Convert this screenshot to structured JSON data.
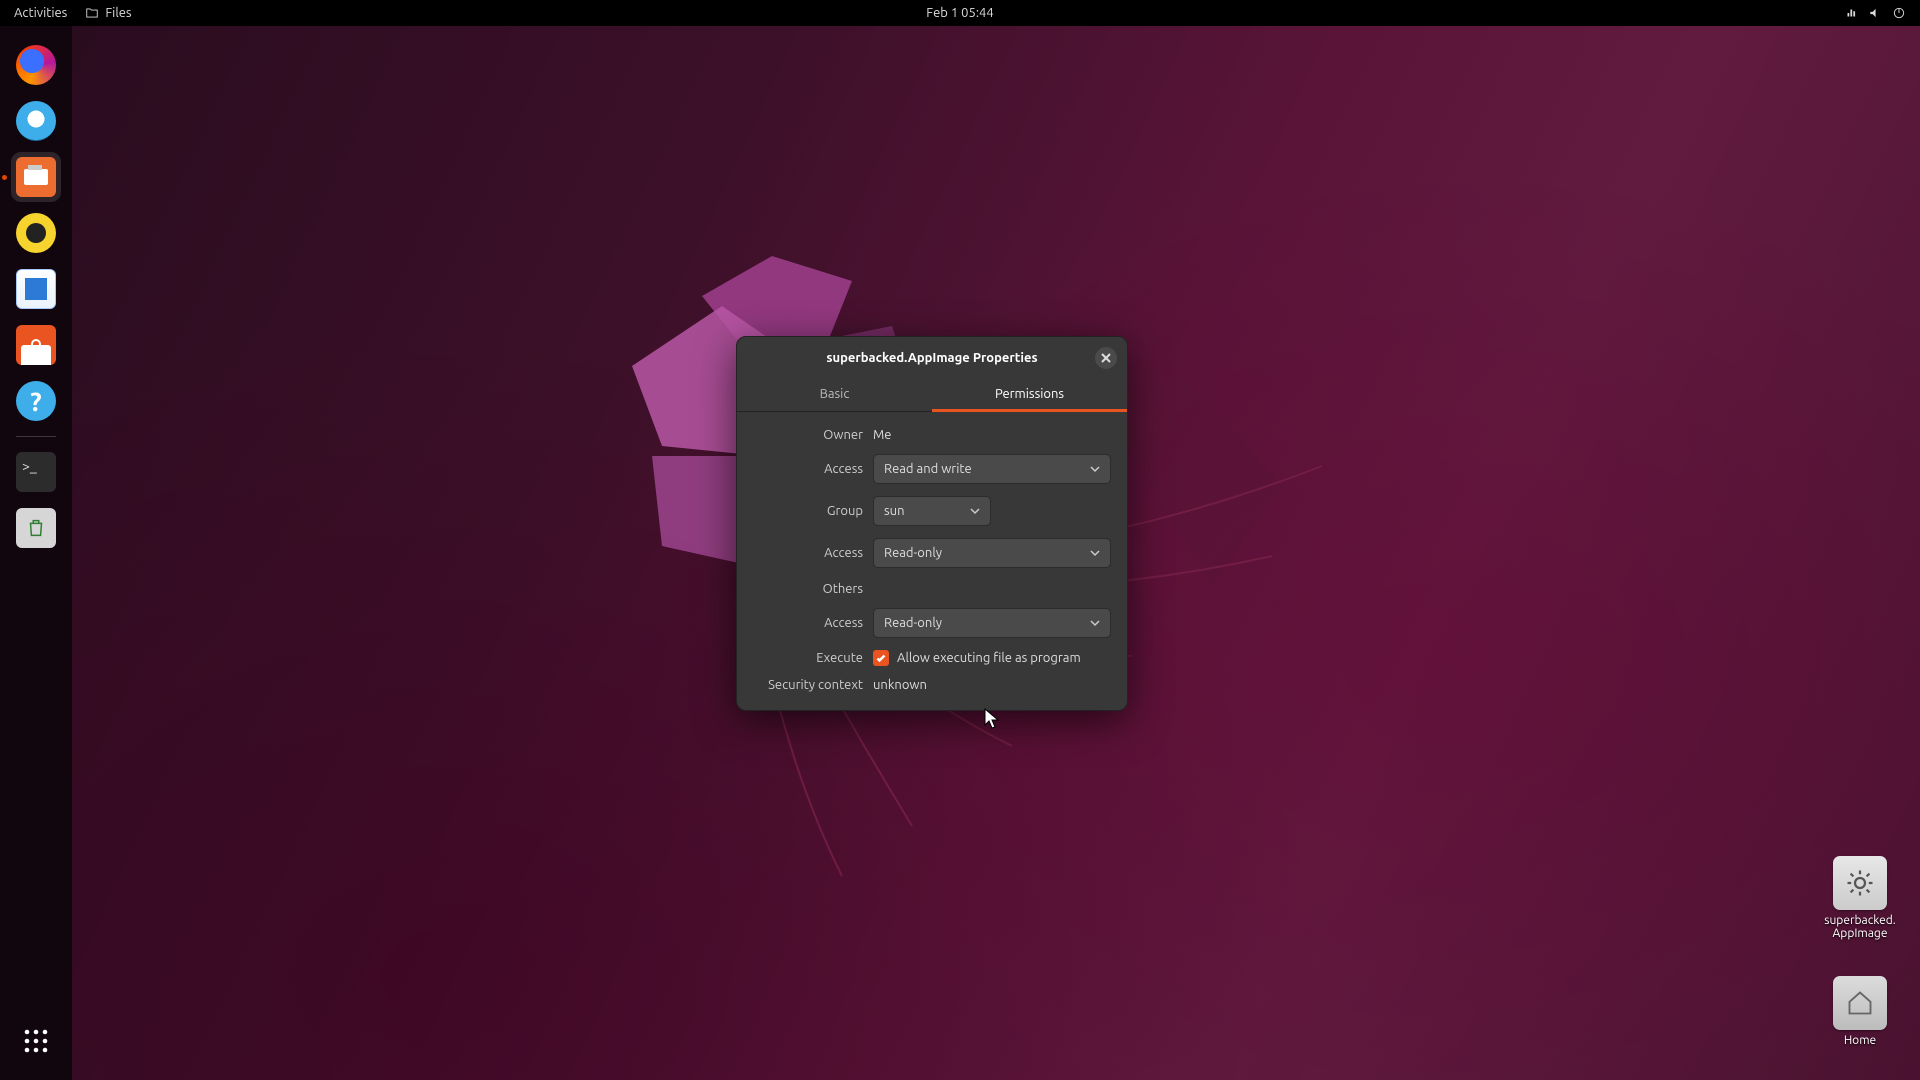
{
  "topbar": {
    "activities": "Activities",
    "app_label": "Files",
    "datetime": "Feb 1  05:44"
  },
  "dock": {
    "items": [
      "firefox",
      "thunderbird",
      "files",
      "rhythmbox",
      "writer",
      "software",
      "help"
    ],
    "extra": [
      "terminal",
      "trash"
    ],
    "show_apps": "Show Applications"
  },
  "desktop_icons": {
    "appimage_label": "superbacked.\nAppImage",
    "home_label": "Home"
  },
  "dialog": {
    "title": "superbacked.AppImage Properties",
    "tabs": {
      "basic": "Basic",
      "permissions": "Permissions"
    },
    "active_tab": "permissions",
    "owner_label": "Owner",
    "owner_value": "Me",
    "access_label": "Access",
    "owner_access": "Read and write",
    "group_label": "Group",
    "group_value": "sun",
    "group_access": "Read-only",
    "others_label": "Others",
    "others_access": "Read-only",
    "execute_label": "Execute",
    "execute_checkbox": "Allow executing file as program",
    "execute_checked": true,
    "security_label": "Security context",
    "security_value": "unknown"
  }
}
